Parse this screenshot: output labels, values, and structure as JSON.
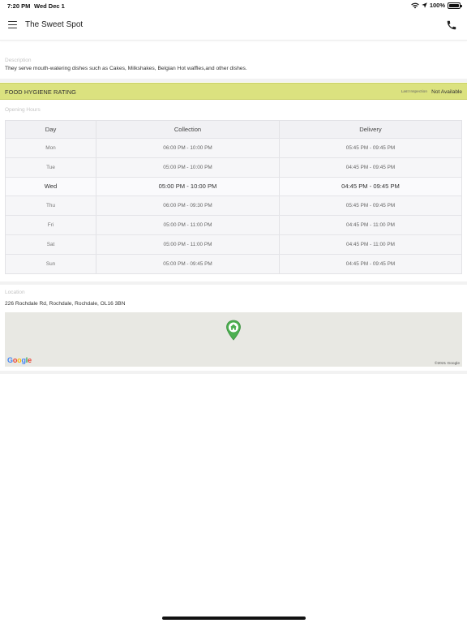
{
  "status_bar": {
    "time": "7:20 PM",
    "date": "Wed Dec 1",
    "battery": "100%",
    "battery_level": 1.0
  },
  "nav": {
    "title": "The Sweet Spot"
  },
  "description": {
    "label": "Description",
    "text": "They serve mouth-watering dishes such as Cakes, Milkshakes, Belgian Hot waffles,and other dishes."
  },
  "hygiene": {
    "label": "FOOD HYGIENE RATING",
    "last_inspection_label": "Last Inspection",
    "last_inspection_value": "Not Available",
    "band_color": "#dbe27f"
  },
  "opening_hours": {
    "label": "Opening Hours",
    "headers": {
      "day": "Day",
      "collection": "Collection",
      "delivery": "Delivery"
    },
    "rows": [
      {
        "day": "Mon",
        "collection": "06:00 PM - 10:00 PM",
        "delivery": "05:45 PM - 09:45 PM"
      },
      {
        "day": "Tue",
        "collection": "05:00 PM - 10:00 PM",
        "delivery": "04:45 PM - 09:45 PM"
      },
      {
        "day": "Wed",
        "collection": "05:00 PM - 10:00 PM",
        "delivery": "04:45 PM - 09:45 PM"
      },
      {
        "day": "Thu",
        "collection": "06:00 PM - 09:30 PM",
        "delivery": "05:45 PM - 09:45 PM"
      },
      {
        "day": "Fri",
        "collection": "05:00 PM - 11:00 PM",
        "delivery": "04:45 PM - 11:00 PM"
      },
      {
        "day": "Sat",
        "collection": "05:00 PM - 11:00 PM",
        "delivery": "04:45 PM - 11:00 PM"
      },
      {
        "day": "Sun",
        "collection": "05:00 PM - 09:45 PM",
        "delivery": "04:45 PM - 09:45 PM"
      }
    ],
    "highlighted_day": "Wed"
  },
  "location": {
    "label": "Location",
    "address": "226 Rochdale Rd, Rochdale, Rochdale, OL16 3BN",
    "map_copyright": "©2021 Google",
    "map_logo": "Google",
    "pin_icon": "home-map-pin-icon",
    "pin_color": "#4caf50"
  }
}
